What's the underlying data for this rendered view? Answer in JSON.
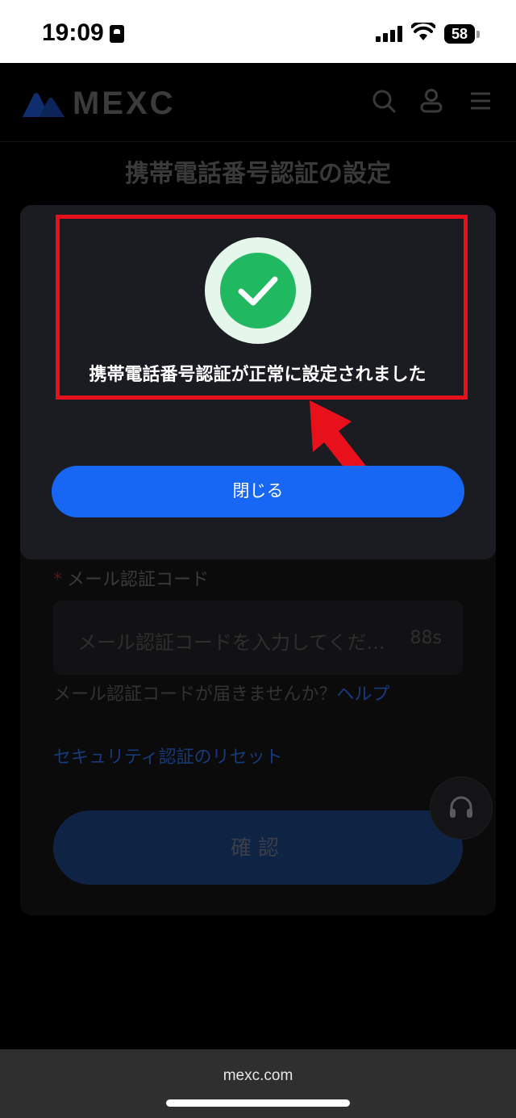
{
  "status_bar": {
    "time": "19:09",
    "battery": "58"
  },
  "header": {
    "brand": "MEXC",
    "icons": [
      "search-icon",
      "user-icon",
      "menu-icon"
    ]
  },
  "page": {
    "title": "携帯電話番号認証の設定"
  },
  "form": {
    "email_code_label": "メール認証コード",
    "required_mark": "*",
    "email_code_placeholder": "メール認証コードを入力してくだ...",
    "countdown": "88s",
    "help_text": "メール認証コードが届きませんか？",
    "help_link": "ヘルプ",
    "reset_link": "セキュリティ認証のリセット",
    "confirm_label": "確認"
  },
  "modal": {
    "success_message": "携帯電話番号認証が正常に設定されました",
    "close_label": "閉じる"
  },
  "browser": {
    "url": "mexc.com"
  },
  "colors": {
    "accent": "#1866f4",
    "success": "#21b862",
    "annotation": "#e8101a",
    "modal_bg": "#1b1c21"
  }
}
